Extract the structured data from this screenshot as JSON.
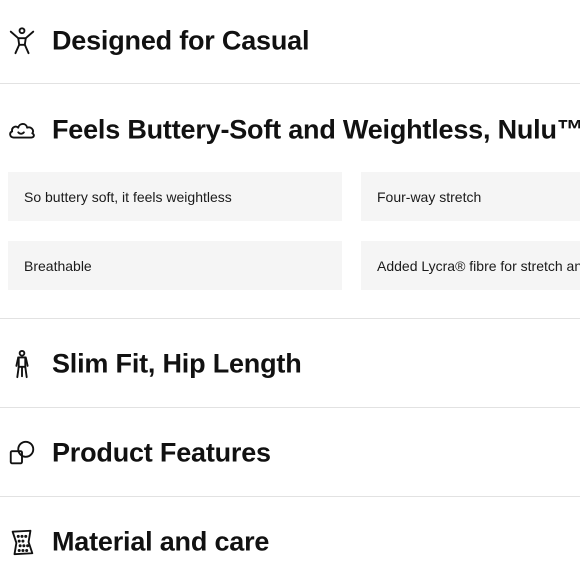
{
  "sections": [
    {
      "title": "Designed for Casual",
      "icon": "person-stretch-icon"
    },
    {
      "title": "Feels Buttery-Soft and Weightless, Nulu™",
      "icon": "cloud-icon"
    },
    {
      "title": "Slim Fit, Hip Length",
      "icon": "person-fit-icon"
    },
    {
      "title": "Product Features",
      "icon": "shapes-icon"
    },
    {
      "title": "Material and care",
      "icon": "fabric-swatch-icon"
    }
  ],
  "features": [
    "So buttery soft, it feels weightless",
    "Four-way stretch",
    "Breathable",
    "Added Lycra® fibre for stretch and shape retention"
  ]
}
